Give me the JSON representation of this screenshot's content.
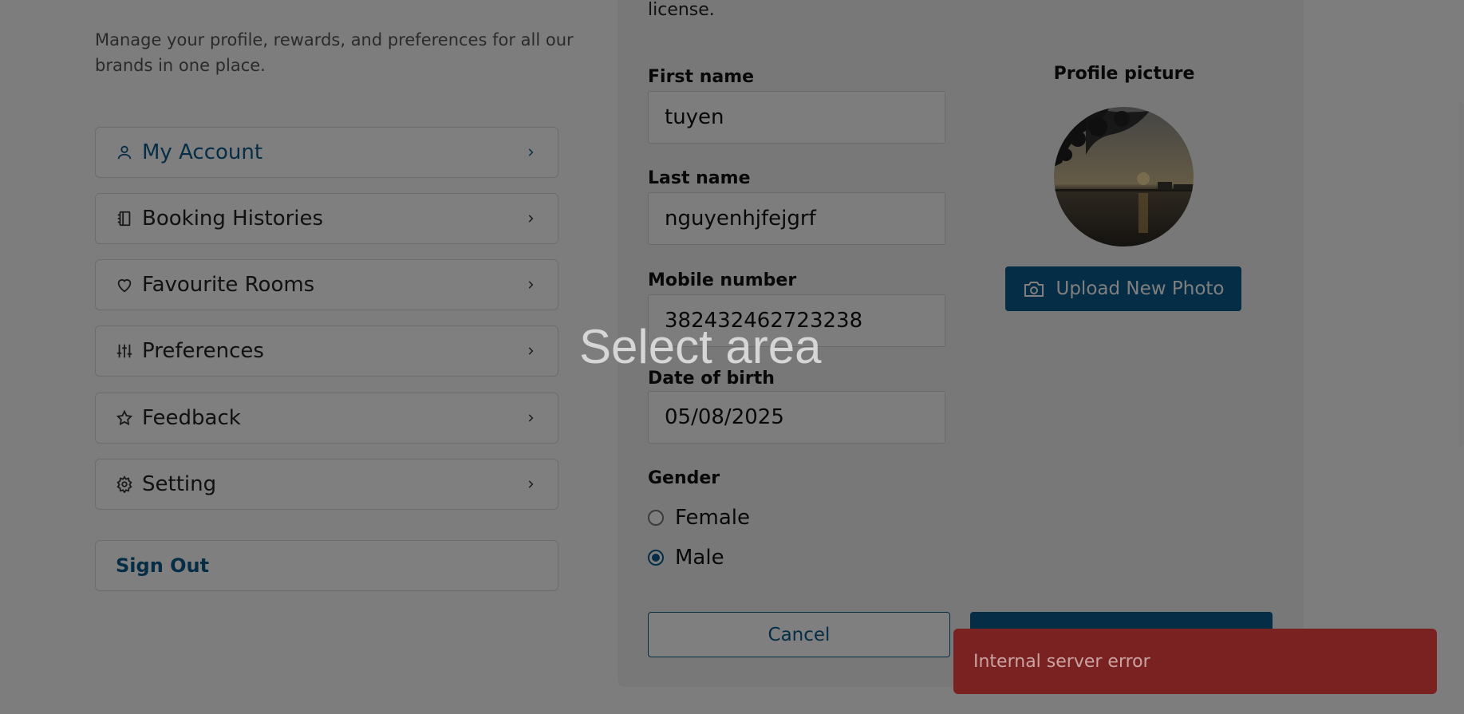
{
  "intro": "Manage your profile, rewards, and preferences for all our brands in one place.",
  "nav": {
    "items": [
      {
        "label": "My Account",
        "icon": "user-icon"
      },
      {
        "label": "Booking Histories",
        "icon": "notebook-icon"
      },
      {
        "label": "Favourite Rooms",
        "icon": "heart-icon"
      },
      {
        "label": "Preferences",
        "icon": "sliders-icon"
      },
      {
        "label": "Feedback",
        "icon": "star-icon"
      },
      {
        "label": "Setting",
        "icon": "gear-icon"
      }
    ],
    "signout": "Sign Out"
  },
  "form": {
    "license_tail": "license.",
    "first_name_label": "First name",
    "first_name_value": "tuyen",
    "last_name_label": "Last name",
    "last_name_value": "nguyenhjfejgrf",
    "mobile_label": "Mobile number",
    "mobile_value": "382432462723238",
    "dob_label": "Date of birth",
    "dob_value": "05/08/2025",
    "gender_label": "Gender",
    "gender_options": [
      "Female",
      "Male"
    ],
    "gender_selected": "Male",
    "cancel_label": "Cancel"
  },
  "profile": {
    "title": "Profile picture",
    "upload_label": "Upload New Photo"
  },
  "overlay": {
    "select_area": "Select area"
  },
  "toast": {
    "message": "Internal server error"
  },
  "colors": {
    "brand": "#0a5a8a",
    "error": "#b83232"
  }
}
